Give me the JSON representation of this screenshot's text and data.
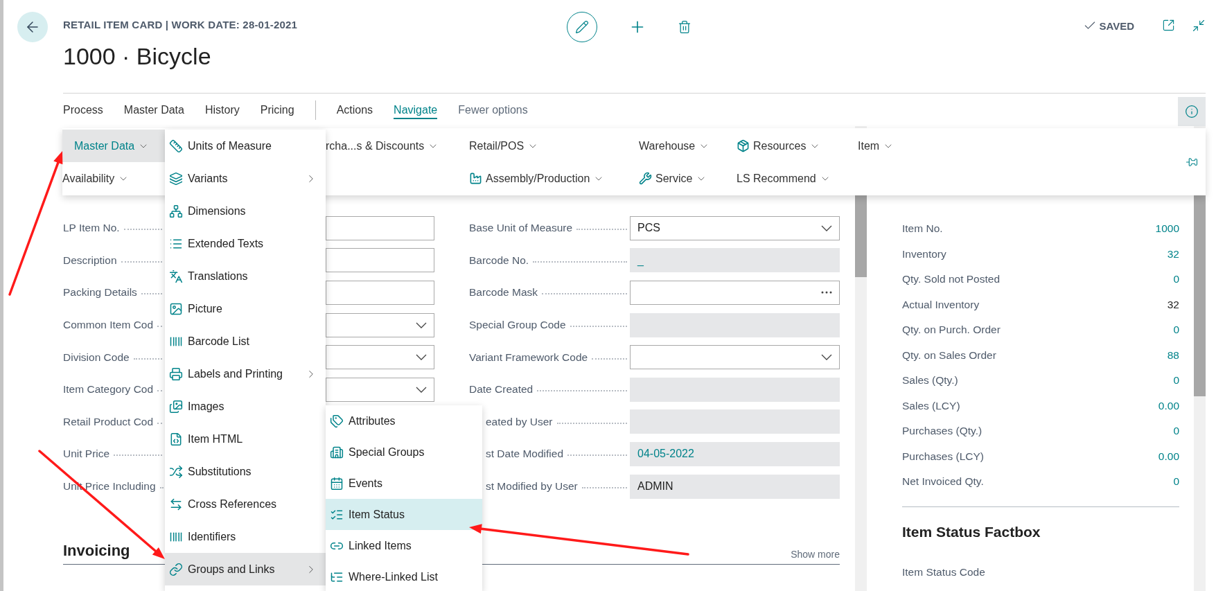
{
  "header": {
    "caption": "RETAIL ITEM CARD | WORK DATE: 28-01-2021",
    "title": "1000 · Bicycle",
    "status": "SAVED"
  },
  "action_groups": [
    {
      "tabs": [
        {
          "label": "Process",
          "selected": false
        },
        {
          "label": "Master Data",
          "selected": false
        },
        {
          "label": "History",
          "selected": false
        },
        {
          "label": "Pricing",
          "selected": false
        }
      ]
    },
    {
      "tabs": [
        {
          "label": "Actions",
          "selected": false
        },
        {
          "label": "Navigate",
          "selected": true
        }
      ]
    }
  ],
  "fewer_options": "Fewer options",
  "navigate_menu": {
    "rows": [
      [
        {
          "label": "Master Data",
          "selected": true
        },
        {
          "label": "rcha...s & Discounts",
          "selected": false
        },
        {
          "label": "Retail/POS",
          "selected": false
        },
        {
          "label": "Warehouse",
          "selected": false
        },
        {
          "label": "Resources",
          "selected": false
        },
        {
          "label": "Item",
          "selected": false
        }
      ],
      [
        {
          "label": "Availability",
          "selected": false
        },
        "",
        {
          "label": "Assembly/Production",
          "selected": false
        },
        {
          "label": "Service",
          "selected": false
        },
        {
          "label": "LS Recommend",
          "selected": false
        }
      ]
    ]
  },
  "submenu": {
    "items": [
      {
        "label": "Units of Measure",
        "has_submenu": false,
        "selected": false
      },
      {
        "label": "Variants",
        "has_submenu": true,
        "selected": false
      },
      {
        "label": "Dimensions",
        "has_submenu": false,
        "selected": false
      },
      {
        "label": "Extended Texts",
        "has_submenu": false,
        "selected": false
      },
      {
        "label": "Translations",
        "has_submenu": false,
        "selected": false
      },
      {
        "label": "Picture",
        "has_submenu": false,
        "selected": false
      },
      {
        "label": "Barcode List",
        "has_submenu": false,
        "selected": false
      },
      {
        "label": "Labels and Printing",
        "has_submenu": true,
        "selected": false
      },
      {
        "label": "Images",
        "has_submenu": false,
        "selected": false
      },
      {
        "label": "Item HTML",
        "has_submenu": false,
        "selected": false
      },
      {
        "label": "Substitutions",
        "has_submenu": false,
        "selected": false
      },
      {
        "label": "Cross References",
        "has_submenu": false,
        "selected": false
      },
      {
        "label": "Identifiers",
        "has_submenu": false,
        "selected": false
      },
      {
        "label": "Groups and Links",
        "has_submenu": true,
        "selected": true
      }
    ]
  },
  "nested_submenu": {
    "items": [
      {
        "label": "Attributes",
        "selected": false
      },
      {
        "label": "Special Groups",
        "selected": false
      },
      {
        "label": "Events",
        "selected": false
      },
      {
        "label": "Item Status",
        "selected": true
      },
      {
        "label": "Linked Items",
        "selected": false
      },
      {
        "label": "Where-Linked List",
        "selected": false
      }
    ]
  },
  "form": {
    "rows": [
      {
        "left": {
          "label": "LP Item No.",
          "field": {
            "kind": "text"
          }
        },
        "right": {
          "label": "Base Unit of Measure",
          "field": {
            "kind": "select",
            "value": "PCS",
            "link": false
          }
        }
      },
      {
        "left": {
          "label": "Description",
          "field": {
            "kind": "text"
          }
        },
        "right": {
          "label": "Barcode No.",
          "field": {
            "kind": "readonly",
            "value": "_",
            "link": true
          }
        }
      },
      {
        "left": {
          "label": "Packing Details",
          "field": {
            "kind": "text"
          }
        },
        "right": {
          "label": "Barcode Mask",
          "field": {
            "kind": "lookup"
          }
        }
      },
      {
        "left": {
          "label": "Common Item Cod",
          "field": {
            "kind": "select"
          }
        },
        "right": {
          "label": "Special Group Code",
          "field": {
            "kind": "readonly"
          }
        }
      },
      {
        "left": {
          "label": "Division Code",
          "field": {
            "kind": "select"
          }
        },
        "right": {
          "label": "Variant Framework Code",
          "field": {
            "kind": "select"
          }
        }
      },
      {
        "left": {
          "label": "Item Category Cod",
          "field": {
            "kind": "select"
          }
        },
        "right": {
          "label": "Date Created",
          "field": {
            "kind": "readonly"
          }
        }
      },
      {
        "left": {
          "label": "Retail Product Cod"
        },
        "right": {
          "label": "eated by User",
          "field": {
            "kind": "readonly"
          }
        }
      },
      {
        "left": {
          "label": "Unit Price"
        },
        "right": {
          "label": "st Date Modified",
          "field": {
            "kind": "readonly",
            "value": "04-05-2022",
            "link": true
          }
        }
      },
      {
        "left": {
          "label": "Unit Price Including"
        },
        "right": {
          "label": "st Modified by User",
          "field": {
            "kind": "readonly",
            "value": "ADMIN",
            "link": false
          }
        }
      }
    ]
  },
  "invoicing": {
    "title": "Invoicing",
    "show_more": "Show more"
  },
  "factbox": {
    "rows": [
      {
        "label": "Item No.",
        "value": "1000",
        "link": true
      },
      {
        "label": "Inventory",
        "value": "32",
        "link": true
      },
      {
        "label": "Qty. Sold not Posted",
        "value": "0",
        "link": true
      },
      {
        "label": "Actual Inventory",
        "value": "32",
        "link": false
      },
      {
        "label": "Qty. on Purch. Order",
        "value": "0",
        "link": true
      },
      {
        "label": "Qty. on Sales Order",
        "value": "88",
        "link": true
      },
      {
        "label": "Sales (Qty.)",
        "value": "0",
        "link": true
      },
      {
        "label": "Sales (LCY)",
        "value": "0.00",
        "link": true
      },
      {
        "label": "Purchases (Qty.)",
        "value": "0",
        "link": true
      },
      {
        "label": "Purchases (LCY)",
        "value": "0.00",
        "link": true
      },
      {
        "label": "Net Invoiced Qty.",
        "value": "0",
        "link": true
      }
    ],
    "section_title": "Item Status Factbox",
    "section_rows": [
      {
        "label": "Item Status Code"
      }
    ]
  }
}
